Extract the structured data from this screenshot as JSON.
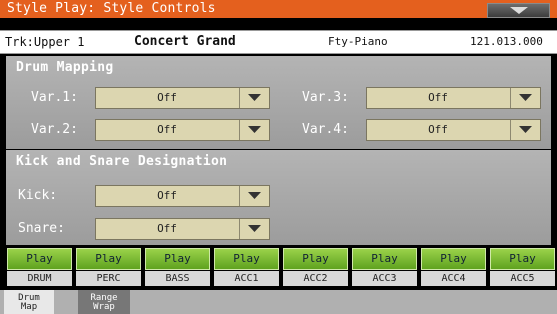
{
  "titlebar": {
    "title": "Style Play: Style Controls"
  },
  "trackbar": {
    "track": "Trk:Upper 1",
    "sound": "Concert Grand",
    "bank": "Fty-Piano",
    "pc": "121.013.000"
  },
  "drum_mapping": {
    "heading": "Drum Mapping",
    "items": [
      {
        "label": "Var.1:",
        "value": "Off"
      },
      {
        "label": "Var.2:",
        "value": "Off"
      },
      {
        "label": "Var.3:",
        "value": "Off"
      },
      {
        "label": "Var.4:",
        "value": "Off"
      }
    ]
  },
  "kick_snare": {
    "heading": "Kick and Snare Designation",
    "items": [
      {
        "label": "Kick:",
        "value": "Off"
      },
      {
        "label": "Snare:",
        "value": "Off"
      }
    ]
  },
  "parts": [
    {
      "state": "Play",
      "name": "DRUM"
    },
    {
      "state": "Play",
      "name": "PERC"
    },
    {
      "state": "Play",
      "name": "BASS"
    },
    {
      "state": "Play",
      "name": "ACC1"
    },
    {
      "state": "Play",
      "name": "ACC2"
    },
    {
      "state": "Play",
      "name": "ACC3"
    },
    {
      "state": "Play",
      "name": "ACC4"
    },
    {
      "state": "Play",
      "name": "ACC5"
    }
  ],
  "tabs": [
    {
      "line1": "Drum",
      "line2": "Map"
    },
    {
      "line1": "Range",
      "line2": "Wrap"
    }
  ],
  "colors": {
    "title_bar": "#e4601e",
    "play_button": "#7cbf34",
    "dropdown": "#dcd6b0"
  }
}
